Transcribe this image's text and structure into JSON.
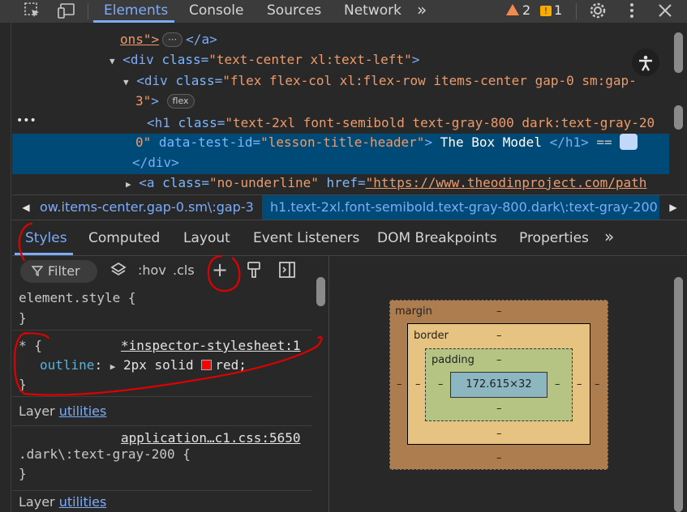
{
  "toolbar": {
    "tabs": [
      "Elements",
      "Console",
      "Sources",
      "Network"
    ],
    "more_tabs": "»",
    "warnings_count": "2",
    "errors_count": "1"
  },
  "dom": {
    "lines": {
      "l0_text": "ons\">",
      "l0_close": "</a>",
      "l1_tag": "<div",
      "l1_attr": "class",
      "l1_val": "\"text-center xl:text-left\"",
      "l1_end": ">",
      "l2_tag": "<div",
      "l2_attr": "class",
      "l2_val": "\"flex flex-col xl:flex-row items-center gap-0 sm:gap-",
      "l3_val": "3\"",
      "l3_end": ">",
      "l3_pill": "flex",
      "sel_tag": "<h1",
      "sel_attr": "class",
      "sel_val": "\"text-2xl font-semibold text-gray-800 dark:text-gray-20",
      "sel2_val": "0\"",
      "sel2_attr": "data-test-id",
      "sel2_attrval": "\"lesson-title-header\"",
      "sel2_end": ">",
      "sel2_text": "The Box Model",
      "sel2_close": "</h1>",
      "sel2_eq": "==",
      "l6_close": "</div>",
      "l7_tag": "<a",
      "l7_attr1": "class",
      "l7_val1": "\"no-underline\"",
      "l7_attr2": "href",
      "l7_val2": "\"https://www.theodinproject.com/path"
    }
  },
  "breadcrumbs": {
    "prev": "ow.items-center.gap-0.sm\\:gap-3",
    "current": "h1.text-2xl.font-semibold.text-gray-800.dark\\:text-gray-200"
  },
  "panel_tabs": [
    "Styles",
    "Computed",
    "Layout",
    "Event Listeners",
    "DOM Breakpoints",
    "Properties"
  ],
  "panel_more": "»",
  "styles": {
    "filter_placeholder": "Filter",
    "hov": ":hov",
    "cls": ".cls",
    "element_style_selector": "element.style {",
    "close_brace": "}",
    "rule1_selector": "* {",
    "rule1_source": "*inspector-stylesheet:1",
    "rule1_prop": "outline",
    "rule1_value_a": "2px solid",
    "rule1_value_b": "red;",
    "layer_label": "Layer",
    "layer_link": "utilities",
    "rule2_source": "application…c1.css:5650",
    "rule2_selector": ".dark\\:text-gray-200 {"
  },
  "box_model": {
    "margin_label": "margin",
    "border_label": "border",
    "padding_label": "padding",
    "content_size": "172.615×32",
    "dash": "–"
  },
  "colors": {
    "accent": "#7cacf8",
    "selected_bg": "#004a77",
    "annotation": "#e00000",
    "swatch": "#ff0000"
  }
}
